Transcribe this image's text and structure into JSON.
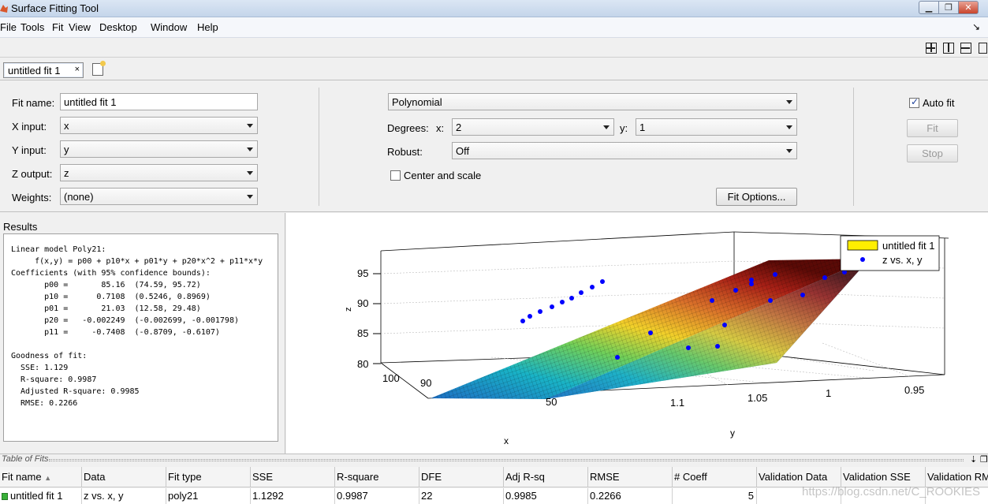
{
  "window": {
    "title": "Surface Fitting Tool",
    "icon": "matlab-icon"
  },
  "menu": [
    "File",
    "Tools",
    "Fit",
    "View",
    "Desktop",
    "Window",
    "Help"
  ],
  "tabs": [
    {
      "label": "untitled fit 1",
      "close": "×"
    }
  ],
  "config": {
    "fit_name_label": "Fit name:",
    "fit_name_value": "untitled fit 1",
    "x_input_label": "X input:",
    "x_input_value": "x",
    "y_input_label": "Y input:",
    "y_input_value": "y",
    "z_output_label": "Z output:",
    "z_output_value": "z",
    "weights_label": "Weights:",
    "weights_value": "(none)",
    "fit_type": "Polynomial",
    "degrees_label": "Degrees:",
    "degree_x_label": "x:",
    "degree_x_value": "2",
    "degree_y_label": "y:",
    "degree_y_value": "1",
    "robust_label": "Robust:",
    "robust_value": "Off",
    "center_scale_label": "Center and scale",
    "center_scale_checked": false,
    "fit_options_label": "Fit Options...",
    "auto_fit_label": "Auto fit",
    "auto_fit_checked": true,
    "fit_button": "Fit",
    "stop_button": "Stop"
  },
  "results": {
    "title": "Results",
    "text": "Linear model Poly21:\n     f(x,y) = p00 + p10*x + p01*y + p20*x^2 + p11*x*y\nCoefficients (with 95% confidence bounds):\n       p00 =       85.16  (74.59, 95.72)\n       p10 =      0.7108  (0.5246, 0.8969)\n       p01 =       21.03  (12.58, 29.48)\n       p20 =   -0.002249  (-0.002699, -0.001798)\n       p11 =     -0.7408  (-0.8709, -0.6107)\n\nGoodness of fit:\n  SSE: 1.129\n  R-square: 0.9987\n  Adjusted R-square: 0.9985\n  RMSE: 0.2266"
  },
  "plot": {
    "z_axis_label": "z",
    "x_axis_label": "x",
    "y_axis_label": "y",
    "z_ticks": [
      "80",
      "85",
      "90",
      "95"
    ],
    "x_ticks": [
      "100",
      "90",
      "50"
    ],
    "y_ticks": [
      "1.1",
      "1.05",
      "1",
      "0.95"
    ],
    "legend": [
      "untitled fit 1",
      "z vs. x, y"
    ],
    "legend_colors": {
      "surface": "#ffee00",
      "points": "#0000ff"
    }
  },
  "table_of_fits": {
    "title": "Table of Fits",
    "columns": [
      "Fit name",
      "Data",
      "Fit type",
      "SSE",
      "R-square",
      "DFE",
      "Adj R-sq",
      "RMSE",
      "# Coeff",
      "Validation Data",
      "Validation SSE",
      "Validation RMSE"
    ],
    "rows": [
      {
        "fit_name": "untitled fit 1",
        "data": "z vs. x, y",
        "fit_type": "poly21",
        "sse": "1.1292",
        "rsq": "0.9987",
        "dfe": "22",
        "adjrsq": "0.9985",
        "rmse": "0.2266",
        "ncoeff": "5",
        "val_data": "",
        "val_sse": "",
        "val_rmse": ""
      }
    ]
  },
  "watermark": "https://blog.csdn.net/C_ROOKIES"
}
